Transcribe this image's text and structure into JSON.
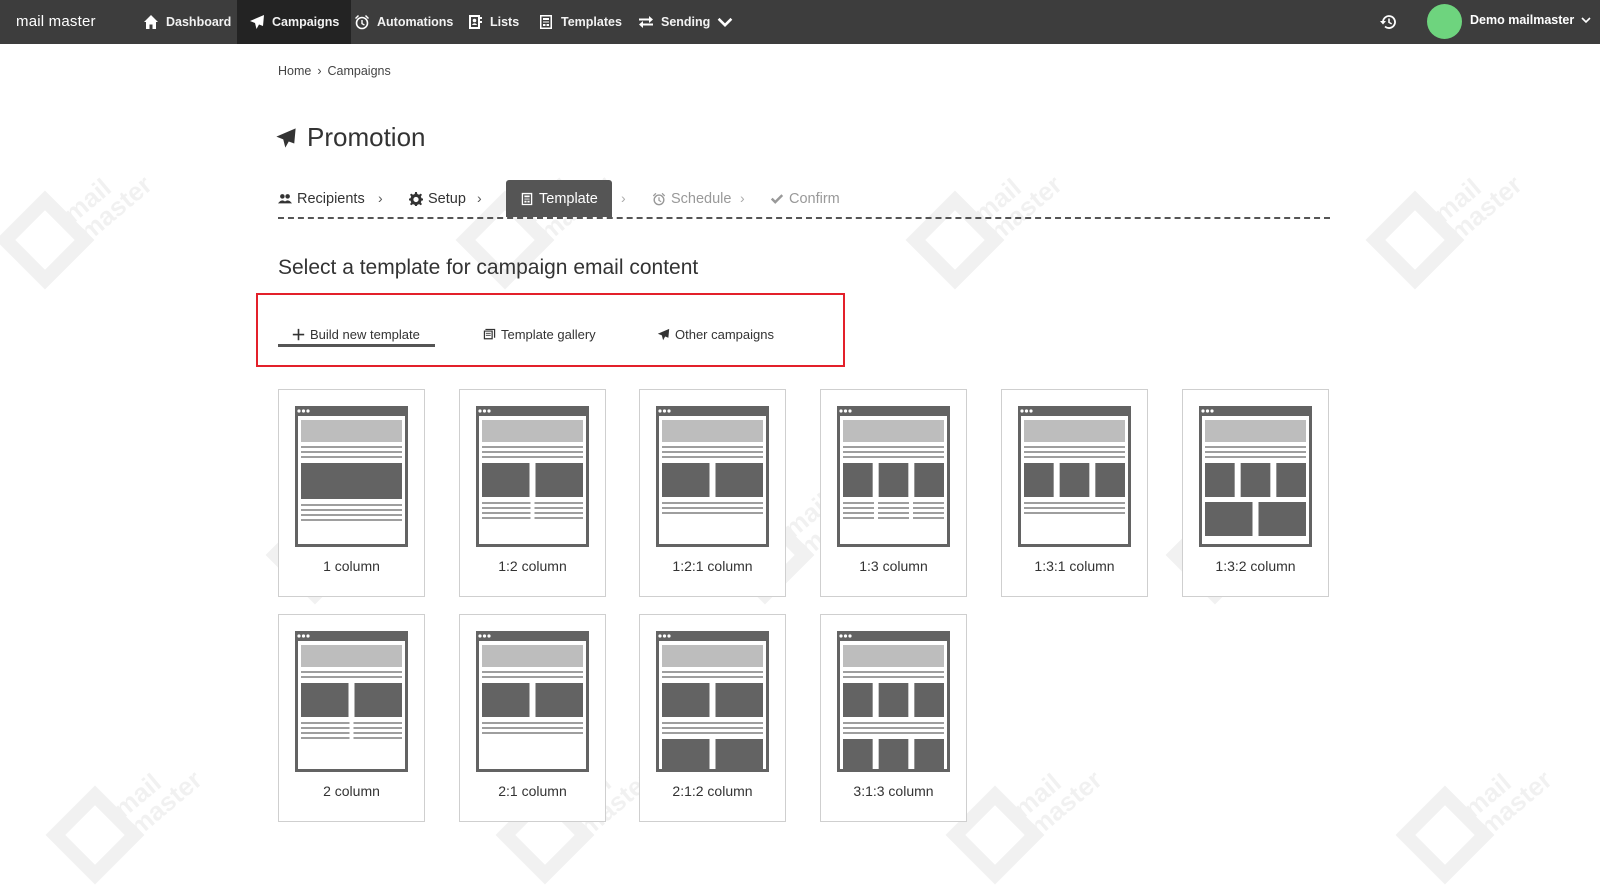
{
  "app": {
    "logo": "mail master"
  },
  "nav": {
    "dashboard": "Dashboard",
    "campaigns": "Campaigns",
    "automations": "Automations",
    "lists": "Lists",
    "templates": "Templates",
    "sending": "Sending"
  },
  "user": {
    "name": "Demo mailmaster",
    "avatar_color": "#6ed47e"
  },
  "breadcrumb": {
    "home": "Home",
    "separator": "›",
    "current": "Campaigns"
  },
  "page": {
    "title": "Promotion"
  },
  "steps": {
    "recipients": "Recipients",
    "setup": "Setup",
    "template": "Template",
    "schedule": "Schedule",
    "confirm": "Confirm",
    "separator": "›",
    "active": "Template"
  },
  "section": {
    "heading": "Select a template for campaign email content",
    "tabs": {
      "build": "Build new template",
      "gallery": "Template gallery",
      "other": "Other campaigns",
      "selected": "Build new template"
    }
  },
  "layouts": [
    "1 column",
    "1:2 column",
    "1:2:1 column",
    "1:3 column",
    "1:3:1 column",
    "1:3:2 column",
    "2 column",
    "2:1 column",
    "2:1:2 column",
    "3:1:3 column"
  ],
  "colors": {
    "nav_bg": "#3d3d3d",
    "nav_active": "#232323",
    "highlight": "#e3202a",
    "step_active": "#555555"
  }
}
